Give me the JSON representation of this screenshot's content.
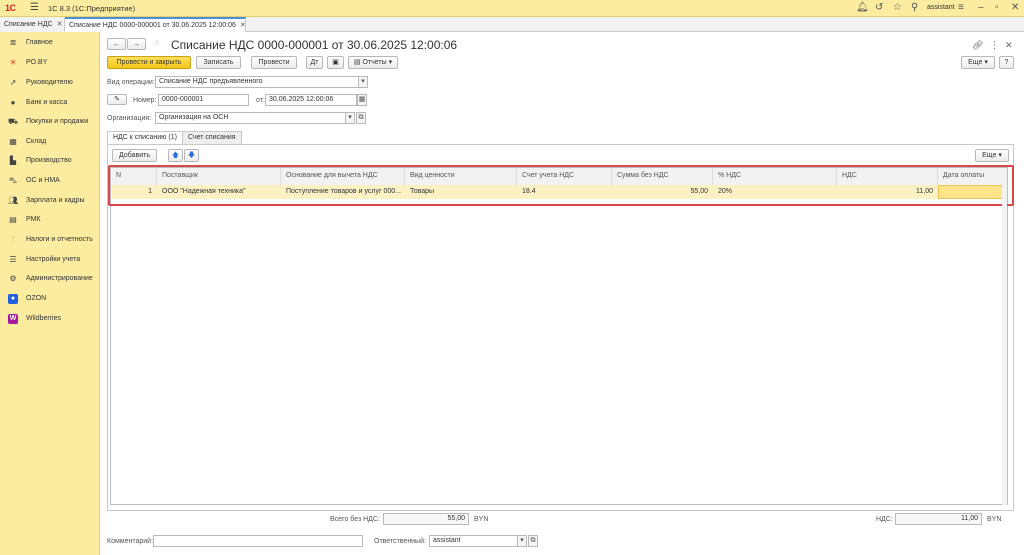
{
  "topbar": {
    "logo": "1С",
    "app_title": "1С 8.3  (1С:Предприятие)",
    "username": "assistant"
  },
  "open_tabs": [
    {
      "label": "Списание НДС"
    },
    {
      "label": "Списание НДС 0000-000001 от 30.06.2025 12:00:06"
    }
  ],
  "sidebar": {
    "items": [
      {
        "label": "Главное",
        "icon": "menu-icon"
      },
      {
        "label": "PO.BY",
        "icon": "poby-icon"
      },
      {
        "label": "Руководителю",
        "icon": "trend-icon"
      },
      {
        "label": "Банк и касса",
        "icon": "bank-icon"
      },
      {
        "label": "Покупки и продажи",
        "icon": "cart-icon"
      },
      {
        "label": "Склад",
        "icon": "warehouse-icon"
      },
      {
        "label": "Производство",
        "icon": "factory-icon"
      },
      {
        "label": "ОС и НМА",
        "icon": "truck-icon"
      },
      {
        "label": "Зарплата и кадры",
        "icon": "people-icon"
      },
      {
        "label": "РМК",
        "icon": "cashier-icon"
      },
      {
        "label": "Налоги и отчетность",
        "icon": "tax-icon"
      },
      {
        "label": "Настройки учета",
        "icon": "settings-list-icon"
      },
      {
        "label": "Администрирование",
        "icon": "gear-icon"
      },
      {
        "label": "OZON",
        "icon": "ozon-icon"
      },
      {
        "label": "Wildberries",
        "icon": "wildberries-icon"
      }
    ]
  },
  "document": {
    "title": "Списание НДС 0000-000001 от 30.06.2025 12:00:06"
  },
  "toolbar": {
    "post_close": "Провести и закрыть",
    "save": "Записать",
    "post": "Провести",
    "reports": "Отчеты",
    "more": "Еще"
  },
  "fields": {
    "operation_label": "Вид операции:",
    "operation_value": "Списание НДС предъявленного",
    "number_label": "Номер:",
    "number_value": "0000-000001",
    "date_label": "от:",
    "date_value": "30.06.2025 12:00:06",
    "org_label": "Организация:",
    "org_value": "Организация на ОСН"
  },
  "inner_tabs": [
    {
      "label": "НДС к списанию (1)"
    },
    {
      "label": "Счет списания"
    }
  ],
  "table_toolbar": {
    "add": "Добавить",
    "more": "Еще"
  },
  "table": {
    "headers": [
      "N",
      "Поставщик",
      "Основание для вычета НДС",
      "Вид ценности",
      "Счет учета НДС",
      "Сумма без НДС",
      "% НДС",
      "НДС",
      "Дата оплаты"
    ],
    "rows": [
      [
        "1",
        "ООО \"Надежная техника\"",
        "Поступление товаров и услуг 000...",
        "Товары",
        "18.4",
        "55,00",
        "20%",
        "11,00",
        ""
      ]
    ]
  },
  "totals": {
    "sum_label": "Всего без НДС:",
    "sum_value": "55,00",
    "sum_currency": "BYN",
    "vat_label": "НДС:",
    "vat_value": "11,00",
    "vat_currency": "BYN"
  },
  "footer": {
    "comment_label": "Комментарий:",
    "comment_value": "",
    "responsible_label": "Ответственный:",
    "responsible_value": "assistant"
  },
  "colors": {
    "accent_yellow": "#f5c518",
    "sidebar_bg": "#fbeca0",
    "highlight_red": "#d94848"
  }
}
